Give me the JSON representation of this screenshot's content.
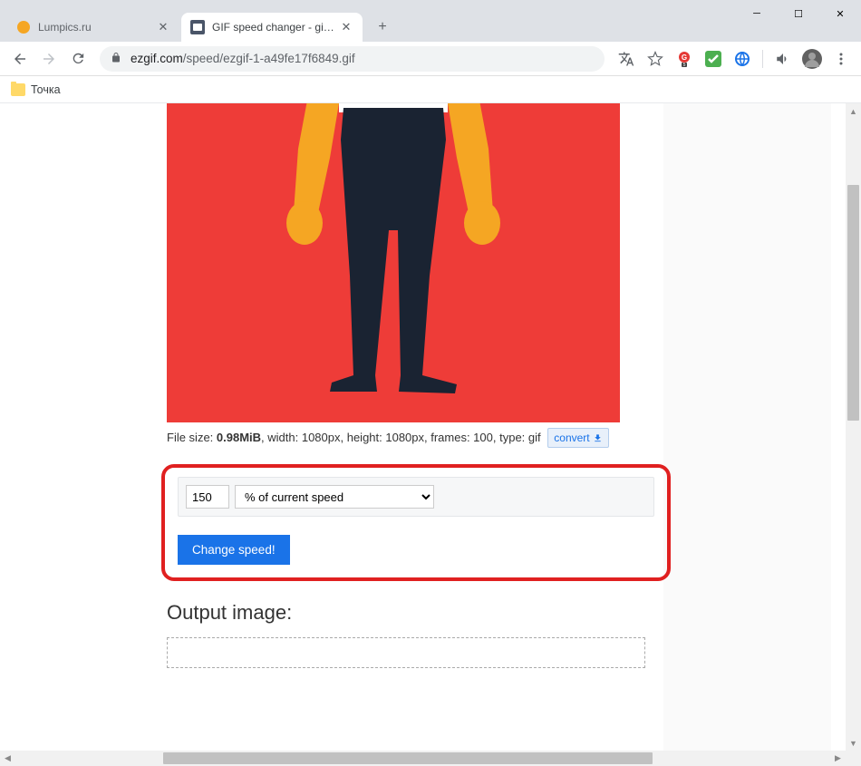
{
  "window": {
    "tabs": [
      {
        "title": "Lumpics.ru",
        "active": false
      },
      {
        "title": "GIF speed changer - gif-man-me",
        "active": true
      }
    ]
  },
  "toolbar": {
    "url_domain": "ezgif.com",
    "url_path": "/speed/ezgif-1-a49fe17f6849.gif"
  },
  "bookmarks": {
    "item1": "Точка"
  },
  "fileinfo": {
    "prefix": "File size: ",
    "size": "0.98MiB",
    "rest": ", width: 1080px, height: 1080px, frames: 100, type: gif",
    "convert": "convert"
  },
  "controls": {
    "speed_value": "150",
    "speed_mode": "% of current speed",
    "button": "Change speed!"
  },
  "output": {
    "heading": "Output image:"
  }
}
